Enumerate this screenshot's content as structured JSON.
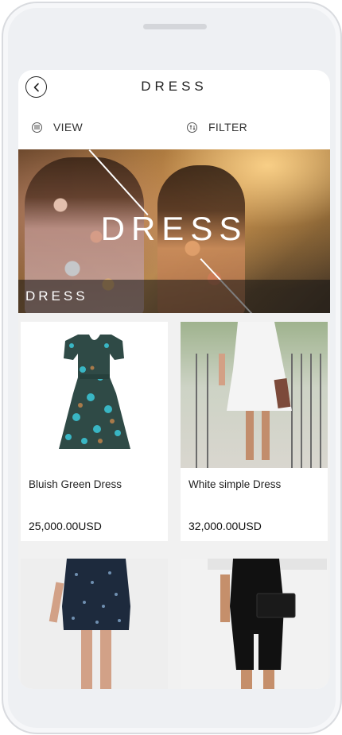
{
  "header": {
    "title": "DRESS",
    "back_icon": "chevron-left-icon"
  },
  "toolbar": {
    "view_label": "VIEW",
    "filter_label": "FILTER",
    "view_icon": "list-icon",
    "filter_icon": "sort-icon"
  },
  "banner": {
    "big_title": "DRESS",
    "caption": "DRESS"
  },
  "products": [
    {
      "name": "Bluish Green Dress",
      "price": "25,000.00USD"
    },
    {
      "name": "White simple Dress",
      "price": "32,000.00USD"
    },
    {
      "name": "",
      "price": ""
    },
    {
      "name": "",
      "price": ""
    }
  ]
}
